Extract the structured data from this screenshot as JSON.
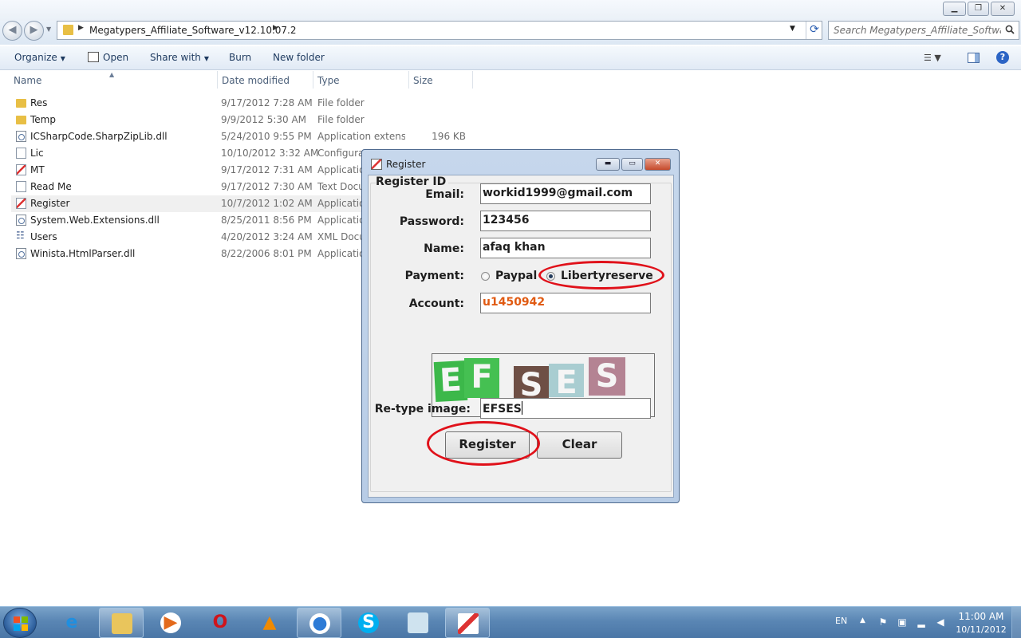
{
  "explorer": {
    "window_controls": {
      "minimize": "▁",
      "maximize": "❐",
      "close": "✕"
    },
    "nav": {
      "back": "◀",
      "forward": "▶",
      "recent": "▼"
    },
    "address": {
      "arrow": "▶",
      "path": "Megatypers_Affiliate_Software_v12.10.07.2",
      "dropdown": "▼",
      "refresh": "⟳"
    },
    "search": {
      "placeholder": "Search Megatypers_Affiliate_Software..."
    },
    "commands": {
      "organize": "Organize",
      "open": "Open",
      "share_with": "Share with",
      "burn": "Burn",
      "new_folder": "New folder",
      "dropdown_glyph": "▼",
      "views": "☰ ▼",
      "help": "?"
    },
    "columns": {
      "name": "Name",
      "date_modified": "Date modified",
      "type": "Type",
      "size": "Size",
      "sort_glyph": "▲"
    },
    "files": [
      {
        "icon": "folder-icon",
        "name": "Res",
        "date": "9/17/2012 7:28 AM",
        "type": "File folder",
        "size": ""
      },
      {
        "icon": "folder-icon",
        "name": "Temp",
        "date": "9/9/2012 5:30 AM",
        "type": "File folder",
        "size": ""
      },
      {
        "icon": "dll-icon",
        "name": "ICSharpCode.SharpZipLib.dll",
        "date": "5/24/2010 9:55 PM",
        "type": "Application extens...",
        "size": "196 KB"
      },
      {
        "icon": "document-icon",
        "name": "Lic",
        "date": "10/10/2012 3:32 AM",
        "type": "Configurat",
        "size": ""
      },
      {
        "icon": "application-icon",
        "name": "MT",
        "date": "9/17/2012 7:31 AM",
        "type": "Applicatio",
        "size": ""
      },
      {
        "icon": "document-icon",
        "name": "Read Me",
        "date": "9/17/2012 7:30 AM",
        "type": "Text Docu",
        "size": ""
      },
      {
        "icon": "application-icon",
        "name": "Register",
        "date": "10/7/2012 1:02 AM",
        "type": "Applicatio",
        "size": "",
        "selected": true
      },
      {
        "icon": "dll-icon",
        "name": "System.Web.Extensions.dll",
        "date": "8/25/2011 8:56 PM",
        "type": "Applicatio",
        "size": ""
      },
      {
        "icon": "xml-icon",
        "name": "Users",
        "date": "4/20/2012 3:24 AM",
        "type": "XML Docu",
        "size": ""
      },
      {
        "icon": "dll-icon",
        "name": "Winista.HtmlParser.dll",
        "date": "8/22/2006 8:01 PM",
        "type": "Applicatio",
        "size": ""
      }
    ]
  },
  "dialog": {
    "title": "Register",
    "controls": {
      "minimize": "▬",
      "maximize": "▭",
      "close": "✕"
    },
    "group_title": "Register ID",
    "fields": {
      "email_label": "Email:",
      "email_value": "workid1999@gmail.com",
      "password_label": "Password:",
      "password_value": "123456",
      "name_label": "Name:",
      "name_value": "afaq khan",
      "payment_label": "Payment:",
      "payment_options": [
        "Paypal",
        "Libertyreserve"
      ],
      "payment_selected": "Libertyreserve",
      "account_label": "Account:",
      "account_value": "u1450942",
      "retype_label": "Re-type image:",
      "retype_value": "EFSES"
    },
    "captcha": {
      "letters": [
        "E",
        "F",
        "S",
        "E",
        "S"
      ],
      "colors": [
        "#3cb84a",
        "#45c052",
        "#6e4f45",
        "#a9cdd1",
        "#b48393"
      ]
    },
    "buttons": {
      "register": "Register",
      "clear": "Clear"
    },
    "annotation_color": "#e0111a"
  },
  "taskbar": {
    "apps": [
      "internet-explorer-icon",
      "file-explorer-icon",
      "media-player-icon",
      "opera-icon",
      "vlc-icon",
      "chrome-icon",
      "skype-icon",
      "notepad-icon",
      "register-app-icon"
    ],
    "tray": {
      "language": "EN",
      "show_hidden": "▲"
    },
    "clock": {
      "time": "11:00 AM",
      "date": "10/11/2012"
    }
  }
}
